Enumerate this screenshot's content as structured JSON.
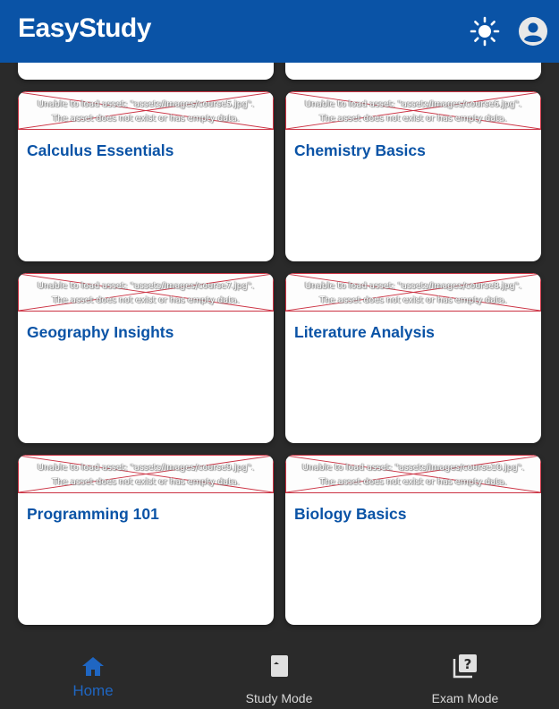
{
  "app": {
    "title": "EasyStudy",
    "theme_icon": "sun-icon",
    "account_icon": "account-circle-icon"
  },
  "colors": {
    "primary": "#0a53a6",
    "background": "#2a2a2a",
    "card": "#ffffff",
    "nav_active": "#1f66c2",
    "nav_inactive": "#d8d8d8",
    "error_border": "#cc3344"
  },
  "courses": [
    {
      "title": "",
      "image_error_line1": "",
      "image_error_line2": ""
    },
    {
      "title": "",
      "image_error_line1": "",
      "image_error_line2": ""
    },
    {
      "title": "Calculus Essentials",
      "image_error_line1": "Unable to load asset: \"assets/images/course5.jpg\".",
      "image_error_line2": "The asset does not exist or has empty data."
    },
    {
      "title": "Chemistry Basics",
      "image_error_line1": "Unable to load asset: \"assets/images/course6.jpg\".",
      "image_error_line2": "The asset does not exist or has empty data."
    },
    {
      "title": "Geography Insights",
      "image_error_line1": "Unable to load asset: \"assets/images/course7.jpg\".",
      "image_error_line2": "The asset does not exist or has empty data."
    },
    {
      "title": "Literature Analysis",
      "image_error_line1": "Unable to load asset: \"assets/images/course8.jpg\".",
      "image_error_line2": "The asset does not exist or has empty data."
    },
    {
      "title": "Programming 101",
      "image_error_line1": "Unable to load asset: \"assets/images/course9.jpg\".",
      "image_error_line2": "The asset does not exist or has empty data."
    },
    {
      "title": "Biology Basics",
      "image_error_line1": "Unable to load asset: \"assets/images/course10.jpg\".",
      "image_error_line2": "The asset does not exist or has empty data."
    }
  ],
  "bottom_nav": {
    "active": "home",
    "items": [
      {
        "label": "Home",
        "icon": "home-icon"
      },
      {
        "label": "Study Mode",
        "icon": "book-icon"
      },
      {
        "label": "Exam Mode",
        "icon": "quiz-icon"
      }
    ]
  }
}
